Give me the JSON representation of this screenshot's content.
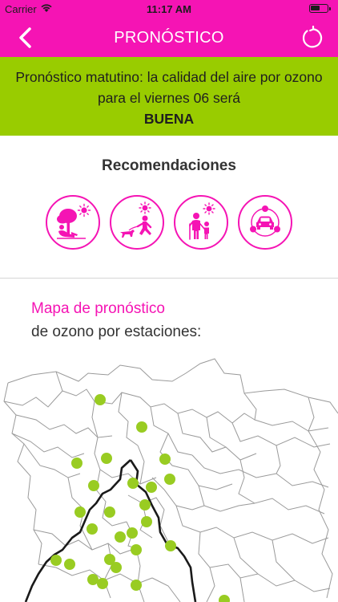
{
  "status_bar": {
    "carrier": "Carrier",
    "time": "11:17 AM"
  },
  "nav": {
    "title": "PRONÓSTICO",
    "back_icon": "chevron-left-icon",
    "refresh_icon": "refresh-icon"
  },
  "forecast": {
    "text": "Pronóstico matutino: la calidad del aire por ozono para el viernes 06 será",
    "quality": "BUENA",
    "banner_color": "#99cc00"
  },
  "recommendations": {
    "title": "Recomendaciones",
    "icons": [
      "outdoor-rest-icon",
      "outdoor-exercise-icon",
      "vulnerable-groups-icon",
      "car-use-icon"
    ]
  },
  "map": {
    "title_line1": "Mapa de pronóstico",
    "title_line2": "de ozono por estaciones:",
    "station_color": "#99cc22"
  },
  "colors": {
    "accent": "#f514b4",
    "good": "#99cc00"
  }
}
